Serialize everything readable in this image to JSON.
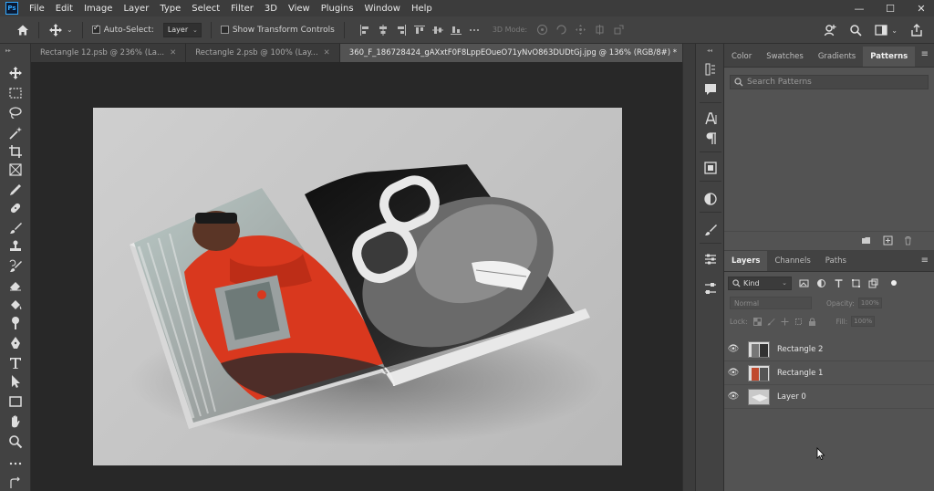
{
  "app": {
    "logo": "Ps",
    "menu": [
      "File",
      "Edit",
      "Image",
      "Layer",
      "Type",
      "Select",
      "Filter",
      "3D",
      "View",
      "Plugins",
      "Window",
      "Help"
    ],
    "window_controls": [
      "—",
      "☐",
      "✕"
    ]
  },
  "options": {
    "auto_select_label": "Auto-Select:",
    "auto_select_checked": true,
    "target_value": "Layer",
    "show_transform_label": "Show Transform Controls",
    "show_transform_checked": false,
    "mode_3d_label": "3D Mode:"
  },
  "tabs": [
    {
      "label": "Rectangle 12.psb @ 236% (La...",
      "active": false
    },
    {
      "label": "Rectangle 2.psb @ 100% (Lay...",
      "active": false
    },
    {
      "label": "360_F_186728424_gAXxtF0F8LppEOueO71yNvO863DUDtGj.jpg @ 136% (RGB/8#) *",
      "active": true
    }
  ],
  "patterns_panel": {
    "tabs": [
      "Color",
      "Swatches",
      "Gradients",
      "Patterns"
    ],
    "active_tab": "Patterns",
    "search_placeholder": "Search Patterns"
  },
  "layers_panel": {
    "tabs": [
      "Layers",
      "Channels",
      "Paths"
    ],
    "active_tab": "Layers",
    "filter_kind": "Kind",
    "blend_mode": "Normal",
    "opacity_label": "Opacity:",
    "opacity_value": "100%",
    "lock_label": "Lock:",
    "fill_label": "Fill:",
    "fill_value": "100%",
    "layers": [
      {
        "name": "Rectangle 2",
        "visible": true,
        "thumb": "rect2"
      },
      {
        "name": "Rectangle 1",
        "visible": true,
        "thumb": "rect1"
      },
      {
        "name": "Layer 0",
        "visible": true,
        "thumb": "layer0"
      }
    ]
  },
  "colors": {
    "accent": "#31a8ff",
    "jacket_red": "#d9381e"
  }
}
